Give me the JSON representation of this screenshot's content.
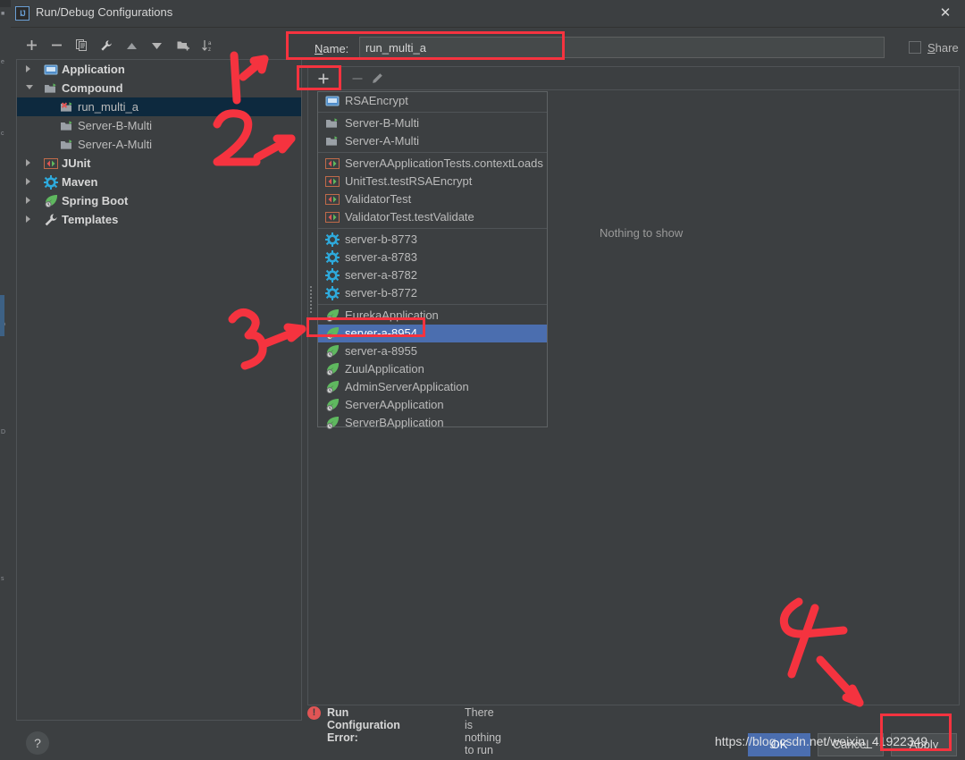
{
  "window": {
    "title": "Run/Debug Configurations",
    "app_icon": "intellij-idea-icon",
    "close_label": "✕"
  },
  "left_toolbar": {
    "items": [
      {
        "name": "add-configuration-button",
        "icon": "plus-icon",
        "tooltip": "Add New Configuration"
      },
      {
        "name": "remove-configuration-button",
        "icon": "minus-icon",
        "tooltip": "Remove Configuration"
      },
      {
        "name": "copy-configuration-button",
        "icon": "copy-icon",
        "tooltip": "Copy Configuration"
      },
      {
        "name": "edit-defaults-button",
        "icon": "wrench-icon",
        "tooltip": "Edit Defaults"
      },
      {
        "name": "move-up-button",
        "icon": "arrow-up-icon",
        "tooltip": "Move Up"
      },
      {
        "name": "move-down-button",
        "icon": "arrow-down-icon",
        "tooltip": "Move Down"
      },
      {
        "name": "new-folder-button",
        "icon": "folder-add-icon",
        "tooltip": "Create New Folder"
      },
      {
        "name": "sort-button",
        "icon": "sort-az-icon",
        "tooltip": "Sort Configurations"
      }
    ]
  },
  "tree": {
    "items": [
      {
        "label": "Application",
        "level": 0,
        "expander": "right",
        "icon": "application-icon",
        "selected": false
      },
      {
        "label": "Compound",
        "level": 0,
        "expander": "down",
        "icon": "compound-icon",
        "selected": false
      },
      {
        "label": "run_multi_a",
        "level": 1,
        "expander": "none",
        "icon": "compound-error-icon",
        "selected": true
      },
      {
        "label": "Server-B-Multi",
        "level": 1,
        "expander": "none",
        "icon": "compound-icon",
        "selected": false
      },
      {
        "label": "Server-A-Multi",
        "level": 1,
        "expander": "none",
        "icon": "compound-icon",
        "selected": false
      },
      {
        "label": "JUnit",
        "level": 0,
        "expander": "right",
        "icon": "junit-icon",
        "selected": false
      },
      {
        "label": "Maven",
        "level": 0,
        "expander": "right",
        "icon": "maven-icon",
        "selected": false
      },
      {
        "label": "Spring Boot",
        "level": 0,
        "expander": "right",
        "icon": "spring-boot-icon",
        "selected": false
      },
      {
        "label": "Templates",
        "level": 0,
        "expander": "right",
        "icon": "wrench-icon",
        "selected": false
      }
    ]
  },
  "name_field": {
    "label": "Name:",
    "label_mnemonic": "N",
    "label_rest": "ame:",
    "value": "run_multi_a",
    "placeholder": ""
  },
  "share": {
    "label_mnemonic": "S",
    "label_rest": "hare",
    "checked": false
  },
  "config_editor": {
    "toolbar": [
      {
        "name": "add-item-button",
        "icon": "plus-icon",
        "glyph": "＋",
        "enabled": true
      },
      {
        "name": "remove-item-button",
        "icon": "minus-icon",
        "glyph": "–",
        "enabled": false
      },
      {
        "name": "edit-item-button",
        "icon": "pencil-icon",
        "glyph": "✎",
        "enabled": false
      }
    ],
    "empty_text": "Nothing to show"
  },
  "popup": {
    "groups": [
      {
        "items": [
          {
            "label": "RSAEncrypt",
            "icon": "application-icon",
            "selected": false
          }
        ]
      },
      {
        "items": [
          {
            "label": "Server-B-Multi",
            "icon": "compound-icon",
            "selected": false
          },
          {
            "label": "Server-A-Multi",
            "icon": "compound-icon",
            "selected": false
          }
        ]
      },
      {
        "items": [
          {
            "label": "ServerAApplicationTests.contextLoads",
            "icon": "junit-icon",
            "selected": false
          },
          {
            "label": "UnitTest.testRSAEncrypt",
            "icon": "junit-icon",
            "selected": false
          },
          {
            "label": "ValidatorTest",
            "icon": "junit-icon",
            "selected": false
          },
          {
            "label": "ValidatorTest.testValidate",
            "icon": "junit-icon",
            "selected": false
          }
        ]
      },
      {
        "items": [
          {
            "label": "server-b-8773",
            "icon": "maven-icon",
            "selected": false
          },
          {
            "label": "server-a-8783",
            "icon": "maven-icon",
            "selected": false
          },
          {
            "label": "server-a-8782",
            "icon": "maven-icon",
            "selected": false
          },
          {
            "label": "server-b-8772",
            "icon": "maven-icon",
            "selected": false
          }
        ]
      },
      {
        "items": [
          {
            "label": "EurekaApplication",
            "icon": "spring-boot-icon",
            "selected": false
          },
          {
            "label": "server-a-8954",
            "icon": "spring-boot-icon",
            "selected": true
          },
          {
            "label": "server-a-8955",
            "icon": "spring-boot-icon",
            "selected": false
          },
          {
            "label": "ZuulApplication",
            "icon": "spring-boot-icon",
            "selected": false
          },
          {
            "label": "AdminServerApplication",
            "icon": "spring-boot-icon",
            "selected": false
          },
          {
            "label": "ServerAApplication",
            "icon": "spring-boot-icon",
            "selected": false
          },
          {
            "label": "ServerBApplication",
            "icon": "spring-boot-icon",
            "selected": false
          }
        ]
      }
    ]
  },
  "error": {
    "icon": "error-icon",
    "glyph": "!",
    "title": "Run Configuration Error:",
    "message": "There is nothing to run"
  },
  "buttons": {
    "help": "?",
    "ok": "OK",
    "cancel": "Cancel",
    "apply": "Apply"
  },
  "watermark": {
    "text": "https://blog.csdn.net/weixin_41922349"
  },
  "annotations": {
    "color": "#f5333f",
    "marks": [
      {
        "name": "annotation-number-1",
        "number": "1",
        "points_to": "name-input"
      },
      {
        "name": "annotation-number-2",
        "number": "2",
        "points_to": "add-item-button"
      },
      {
        "name": "annotation-number-3",
        "number": "3",
        "points_to": "popup-item-server-a-8954"
      },
      {
        "name": "annotation-number-4",
        "number": "4",
        "points_to": "apply-button"
      }
    ],
    "highlight_boxes": [
      "name-field-box",
      "add-item-button-box",
      "popup-selected-item-box",
      "apply-button-box"
    ]
  },
  "colors": {
    "background": "#3c3f41",
    "selection_blue": "#4b6eaf",
    "tree_selection": "#0d293e",
    "annotation_red": "#f5333f",
    "error_red": "#e05555",
    "text": "#bbbbbb"
  }
}
